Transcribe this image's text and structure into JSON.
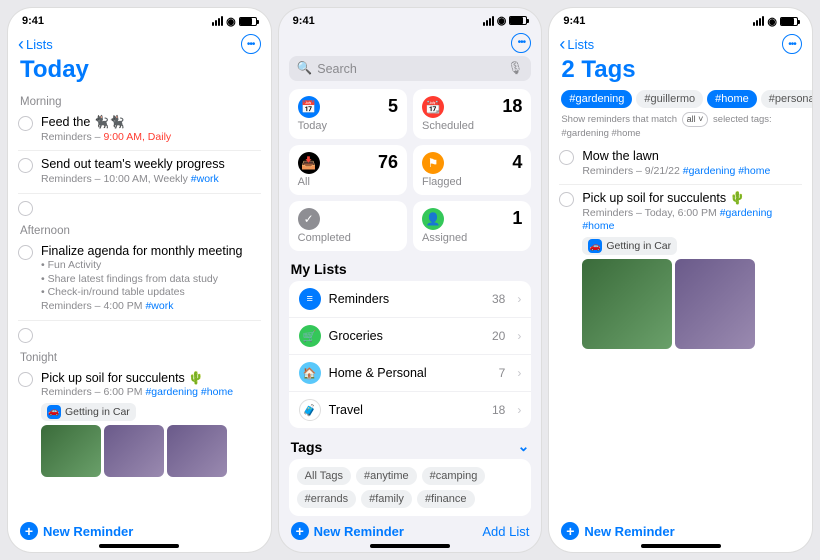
{
  "status": {
    "time": "9:41"
  },
  "screen1": {
    "back": "Lists",
    "title": "Today",
    "sections": [
      {
        "label": "Morning",
        "items": [
          {
            "title": "Feed the 🐈‍⬛🐈‍⬛",
            "sub_prefix": "Reminders – ",
            "sub_time": "9:00 AM, Daily",
            "time_red": true
          },
          {
            "title": "Send out team's weekly progress",
            "sub_prefix": "Reminders – 10:00 AM, Weekly ",
            "sub_tag": "#work"
          }
        ]
      },
      {
        "label": "Afternoon",
        "items": [
          {
            "title": "Finalize agenda for monthly meeting",
            "bullets": [
              "• Fun Activity",
              "• Share latest findings from data study",
              "• Check-in/round table updates"
            ],
            "sub_prefix": "Reminders – 4:00 PM ",
            "sub_tag": "#work"
          }
        ]
      },
      {
        "label": "Tonight",
        "items": [
          {
            "title": "Pick up soil for succulents 🌵",
            "sub_prefix": "Reminders – 6:00 PM ",
            "sub_tag": "#gardening #home",
            "chip": "Getting in Car"
          }
        ]
      }
    ],
    "new_reminder": "New Reminder"
  },
  "screen2": {
    "search_placeholder": "Search",
    "cards": [
      {
        "label": "Today",
        "count": 5,
        "color": "#007aff",
        "glyph": "📅"
      },
      {
        "label": "Scheduled",
        "count": 18,
        "color": "#ff3b30",
        "glyph": "📆"
      },
      {
        "label": "All",
        "count": 76,
        "color": "#000000",
        "glyph": "📥"
      },
      {
        "label": "Flagged",
        "count": 4,
        "color": "#ff9500",
        "glyph": "⚑"
      },
      {
        "label": "Completed",
        "count": "",
        "color": "#8e8e93",
        "glyph": "✓"
      },
      {
        "label": "Assigned",
        "count": 1,
        "color": "#34c759",
        "glyph": "👤"
      }
    ],
    "mylists_header": "My Lists",
    "lists": [
      {
        "name": "Reminders",
        "count": 38,
        "color": "#007aff",
        "glyph": "≡"
      },
      {
        "name": "Groceries",
        "count": 20,
        "color": "#34c759",
        "glyph": "🛒"
      },
      {
        "name": "Home & Personal",
        "count": 7,
        "color": "#5ac8fa",
        "glyph": "🏠"
      },
      {
        "name": "Travel",
        "count": 18,
        "color": "#ffffff",
        "glyph": "🧳",
        "count_blue": true
      }
    ],
    "tags_header": "Tags",
    "tags": [
      "All Tags",
      "#anytime",
      "#camping",
      "#errands",
      "#family",
      "#finance"
    ],
    "new_reminder": "New Reminder",
    "add_list": "Add List"
  },
  "screen3": {
    "back": "Lists",
    "title": "2 Tags",
    "filter_tags": [
      {
        "t": "#gardening",
        "sel": true
      },
      {
        "t": "#guillermo",
        "sel": false
      },
      {
        "t": "#home",
        "sel": true
      },
      {
        "t": "#personal",
        "sel": false
      }
    ],
    "filter_sub_pre": "Show reminders that match ",
    "filter_sub_pill": "all ˅",
    "filter_sub_post": " selected tags: #gardening #home",
    "items": [
      {
        "title": "Mow the lawn",
        "sub_prefix": "Reminders – 9/21/22 ",
        "sub_tag": "#gardening #home"
      },
      {
        "title": "Pick up soil for succulents 🌵",
        "sub_prefix": "Reminders – Today, 6:00 PM ",
        "sub_tag": "#gardening #home",
        "chip": "Getting in Car",
        "thumbs": true
      }
    ],
    "new_reminder": "New Reminder"
  }
}
